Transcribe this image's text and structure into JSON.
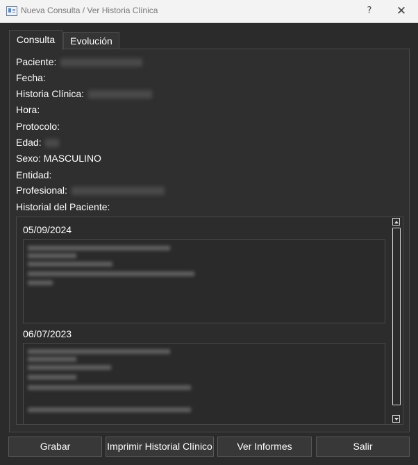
{
  "window": {
    "title": "Nueva Consulta / Ver Historia Clínica",
    "help_label": "?",
    "close_label": "✕"
  },
  "tabs": [
    {
      "label": "Consulta",
      "active": true
    },
    {
      "label": "Evolución",
      "active": false
    }
  ],
  "fields": {
    "paciente": "Paciente:",
    "fecha": "Fecha:",
    "historia": "Historia Clínica:",
    "hora": "Hora:",
    "protocolo": "Protocolo:",
    "edad": "Edad:",
    "sexo": "Sexo:",
    "sexo_value": "MASCULINO",
    "entidad": "Entidad:",
    "profesional": "Profesional:",
    "historial": "Historial del Paciente:"
  },
  "history": [
    {
      "date": "05/09/2024"
    },
    {
      "date": "06/07/2023"
    }
  ],
  "buttons": {
    "grabar": "Grabar",
    "imprimir": "Imprimir Historial Clínico",
    "ver_informes": "Ver Informes",
    "salir": "Salir"
  },
  "colors": {
    "background": "#2b2b2b",
    "panel": "#2f2f2f",
    "border": "#4b4b4b",
    "titlebar": "#f3f3f3"
  },
  "icons": {
    "app": "window-app-icon",
    "help": "help-icon",
    "close": "close-icon"
  }
}
